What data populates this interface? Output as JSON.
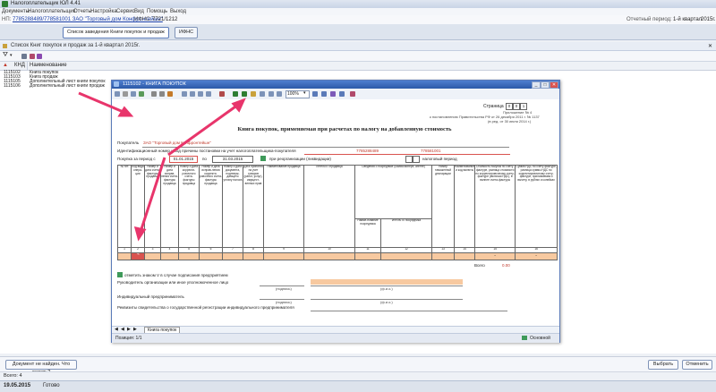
{
  "app": {
    "title": "Налогоплательщик ЮЛ 4.41",
    "menu": [
      "Документы",
      "Налогоплательщик",
      "Отчеты",
      "Настройка",
      "Сервис",
      "Вид",
      "Помощь",
      "Выход"
    ],
    "info": {
      "inn_label": "НП:",
      "inn_value": "7785288489/778581001 ЗАО \"Торговый дом Конфронтейшн\"",
      "ifns_label": "ИФНС:",
      "ifns_value": "7721/1212",
      "period_label": "Отчетный период:",
      "period_value": "1-й квартал",
      "year": "2015г."
    },
    "tabs": [
      {
        "label": "Список заведения Книги покупок и продаж"
      },
      {
        "label": "ИФНС"
      }
    ]
  },
  "doc": {
    "title": "Список Книг покупок и продаж за 1-й квартал 2015г.",
    "columns": {
      "code": "КНД",
      "name": "Наименование"
    },
    "rows": [
      {
        "code": "1115102",
        "name": "Книга покупок"
      },
      {
        "code": "1115103",
        "name": "Книга продаж"
      },
      {
        "code": "1115105",
        "name": "Дополнительный лист книги покупок"
      },
      {
        "code": "1115106",
        "name": "Дополнительный лист книги продаж"
      }
    ]
  },
  "window": {
    "title": "1115102 - КНИГА ПОКУПОК",
    "zoom": "100%",
    "sheet": {
      "page_label": "Страница",
      "page_digits": [
        "0",
        "0",
        "1"
      ],
      "note1": "Приложение № 4",
      "note2": "к постановлению Правительства РФ от 26 декабря 2011 г. № 1137",
      "note3": "(в ред. от 30 июля 2014 г.)",
      "heading": "Книга покупок, применяемая при расчетах по налогу на добавленную стоимость",
      "buyer_label": "Покупатель",
      "buyer_value": "ЗАО \"Торговый дом Конфронтейшн\"",
      "inn_label": "Идентификационный номер и код причины постановки на учет налогоплательщика-покупателя",
      "inn_value": "7785288489",
      "kpp_value": "778581001",
      "period_label": "Покупка за период с",
      "date_from": "01.01.2015",
      "to_label": "по",
      "date_to": "31.03.2015",
      "reorg_label": "при реорганизации (ликвидации)",
      "tax_period_label": "налоговый период",
      "col_headers": [
        "№ п/п",
        "Код вида опера-ции",
        "Номер и дата счета-фактуры продавца",
        "Номер и дата исправ-ления счета-фактуры продавца",
        "Номер и дата корректи-ровочного счета-фактуры продавца",
        "Номер и дата исправ-ления корректи-ровочного счета-фактуры продавца",
        "Номер и дата документа, подтверж-дающего уплату налога",
        "Дата принятия на учет товаров (работ, услуг), имущест-венных прав",
        "Наименование продавца",
        "ИНН/КПП продавца",
        "Сведения о посреднике (комиссионере, агенте)",
        "Номер таможенной декларации",
        "Наименование и код валюты",
        "Стоимость покупок по счету-фактуре, разница стоимости по корректировочному счету-фактуре (включая НДС), в валюте счета-фактуры",
        "Сумма НДС по счету-фактуре, разница суммы НДС по корректировочному счету-фактуре, принимаемая к вычету, в рублях и копейках"
      ],
      "sub_headers": [
        "Наиме-нование посредника",
        "ИНН/КПП посредника"
      ],
      "col_numbers": [
        "1",
        "2",
        "3",
        "4",
        "5",
        "6",
        "7",
        "8",
        "9",
        "10",
        "11",
        "12",
        "13",
        "14",
        "15",
        "16"
      ],
      "dash": "-",
      "total_label": "Всего",
      "total_value": "0.00",
      "sign_check_label": "отметить знаком V в случае подписания предприятием",
      "head_label": "Руководитель организации или иное уполномоченное лицо",
      "sign_hint": "(подпись)",
      "fio_hint": "(ф.и.о.)",
      "ip_label": "Индивидуальный предприниматель",
      "cert_label": "Реквизиты свидетельства о государственной регистрации индивидуального предпринимателя"
    },
    "bottom_tab": "Книга покупок",
    "status_left": "Позиция: 1/1",
    "status_right": "Основной"
  },
  "bottom": {
    "help_button": "Документ не найден. Что делать?",
    "select_button": "Выбрать",
    "cancel_button": "Отменить",
    "count": "Всего: 4",
    "date": "19.05.2015",
    "status": "Готово"
  },
  "colors": {
    "accent": "#2c5aa8",
    "arrow": "#e8356b",
    "highlight": "#f7c9a0"
  }
}
